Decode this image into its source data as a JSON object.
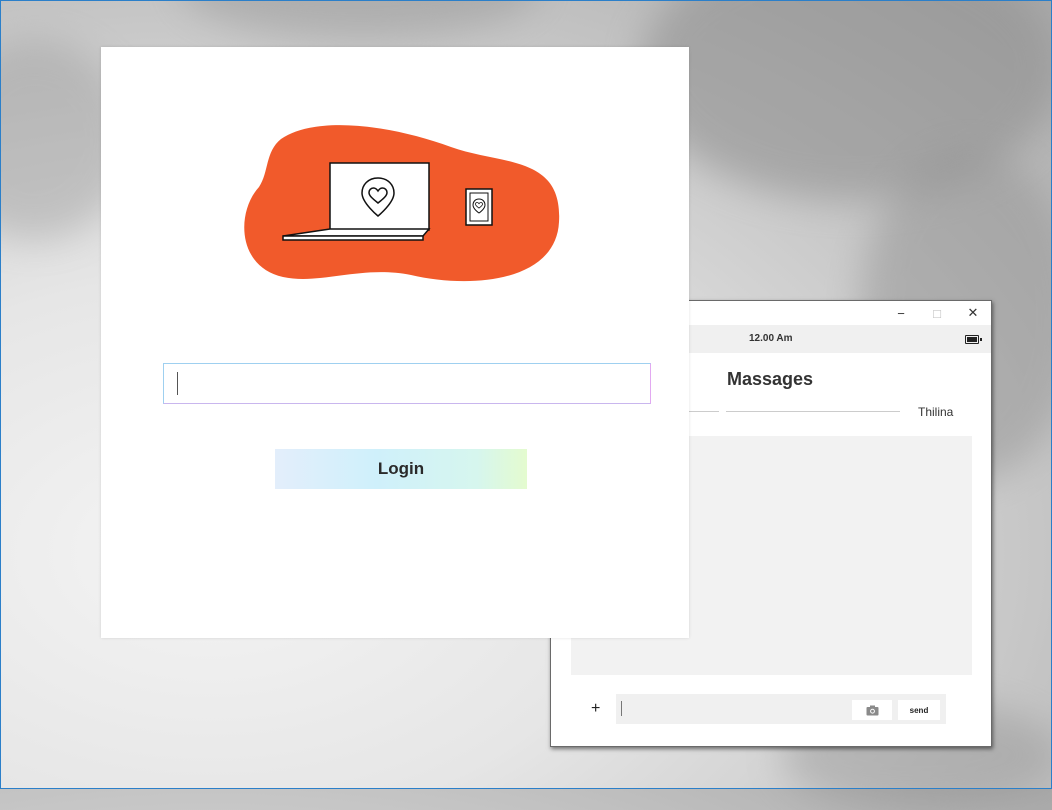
{
  "login": {
    "username_value": "",
    "login_label": "Login"
  },
  "chat": {
    "window_controls": {
      "minimize": "−",
      "maximize": "□",
      "close": "✕"
    },
    "status_time": "12.00 Am",
    "title": "Massages",
    "contact_name": "Thilina",
    "add_label": "+",
    "message_value": "",
    "send_label": "send"
  },
  "icons": {
    "battery": "battery-icon",
    "camera": "camera-icon",
    "laptop": "laptop-icon",
    "tablet": "tablet-icon",
    "heart_pin": "heart-pin-icon"
  },
  "colors": {
    "blob": "#f15a2b",
    "login_gradient_start": "#e3eefb",
    "login_gradient_end": "#e4fbcf",
    "desktop_border": "#2b7fc9"
  }
}
